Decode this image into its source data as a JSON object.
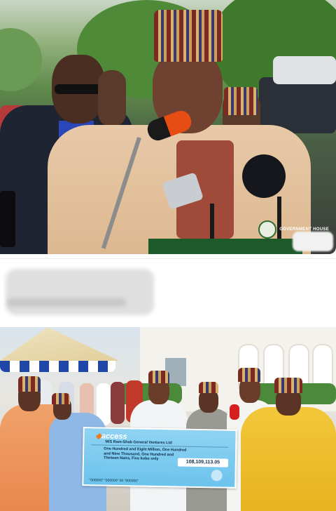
{
  "top_photo": {
    "watermark_text": "GOVERNMENT HOUSE"
  },
  "middle_band": {
    "blurred_heading": "",
    "blurred_line": ""
  },
  "bottom_photo": {
    "cheque": {
      "bank_logo": "access",
      "payee": "M/S Ram-Shab General Ventures Ltd",
      "amount_words": "One Hundred and Eight Million, One Hundred and Nine Thousand, One Hundred and Thirteen Naira, Five kobo only",
      "amount_figures": "108,109,113.05",
      "account_zeros": "\"000000\" \"000000\" 00 \"000000\""
    }
  }
}
